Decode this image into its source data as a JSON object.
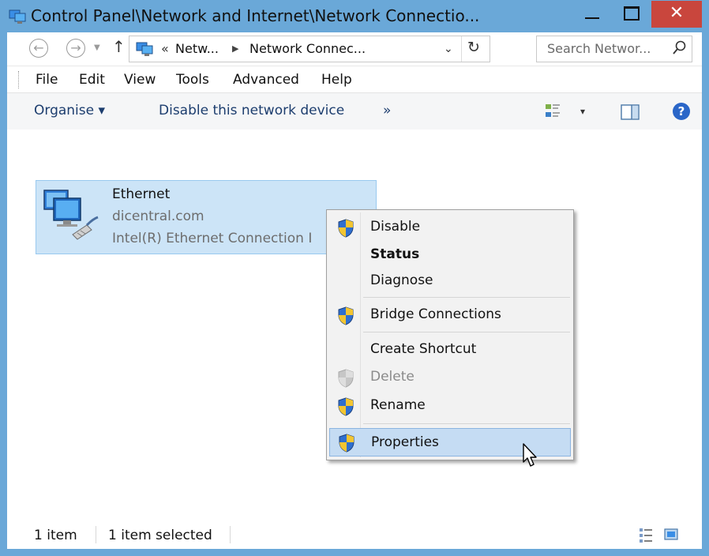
{
  "window": {
    "title": "Control Panel\\Network and Internet\\Network Connectio...",
    "close_glyph": "✕"
  },
  "address_bar": {
    "back_glyph": "←",
    "forward_glyph": "→",
    "up_glyph": "↑",
    "overflow_glyph": "«",
    "crumbs": [
      "Netw...",
      "Network Connec..."
    ],
    "crumb_separator": "▶",
    "dropdown_glyph": "⌄",
    "refresh_glyph": "↻",
    "search_placeholder": "Search Networ..."
  },
  "menubar": {
    "items": [
      "File",
      "Edit",
      "View",
      "Tools",
      "Advanced",
      "Help"
    ]
  },
  "command_bar": {
    "organise": "Organise ▾",
    "disable_device": "Disable this network device",
    "more": "»",
    "view_dropdown": "▾",
    "help": "?"
  },
  "connection": {
    "name": "Ethernet",
    "domain": "dicentral.com",
    "adapter": "Intel(R) Ethernet Connection I"
  },
  "context_menu": {
    "items": [
      {
        "label": "Disable",
        "shield": true,
        "style": "normal"
      },
      {
        "label": "Status",
        "shield": false,
        "style": "bold"
      },
      {
        "label": "Diagnose",
        "shield": false,
        "style": "normal"
      },
      {
        "label": "Bridge Connections",
        "shield": true,
        "style": "normal"
      },
      {
        "label": "Create Shortcut",
        "shield": false,
        "style": "normal"
      },
      {
        "label": "Delete",
        "shield": true,
        "style": "disabled"
      },
      {
        "label": "Rename",
        "shield": true,
        "style": "normal"
      },
      {
        "label": "Properties",
        "shield": true,
        "style": "highlighted"
      }
    ]
  },
  "status_bar": {
    "item_count": "1 item",
    "selection": "1 item selected"
  },
  "colors": {
    "title_bar": "#6aa8d8",
    "close_button": "#c9463d",
    "selection": "#cce4f7",
    "menu_highlight": "#c5dcf3",
    "command_text": "#1c3d6e"
  },
  "icons": [
    "network-connections-icon",
    "back-arrow-icon",
    "forward-arrow-icon",
    "up-arrow-icon",
    "refresh-icon",
    "search-icon",
    "change-view-icon",
    "preview-pane-icon",
    "help-icon",
    "network-adapter-icon",
    "uac-shield-icon",
    "mouse-cursor-icon",
    "details-view-icon",
    "large-icons-view-icon"
  ]
}
